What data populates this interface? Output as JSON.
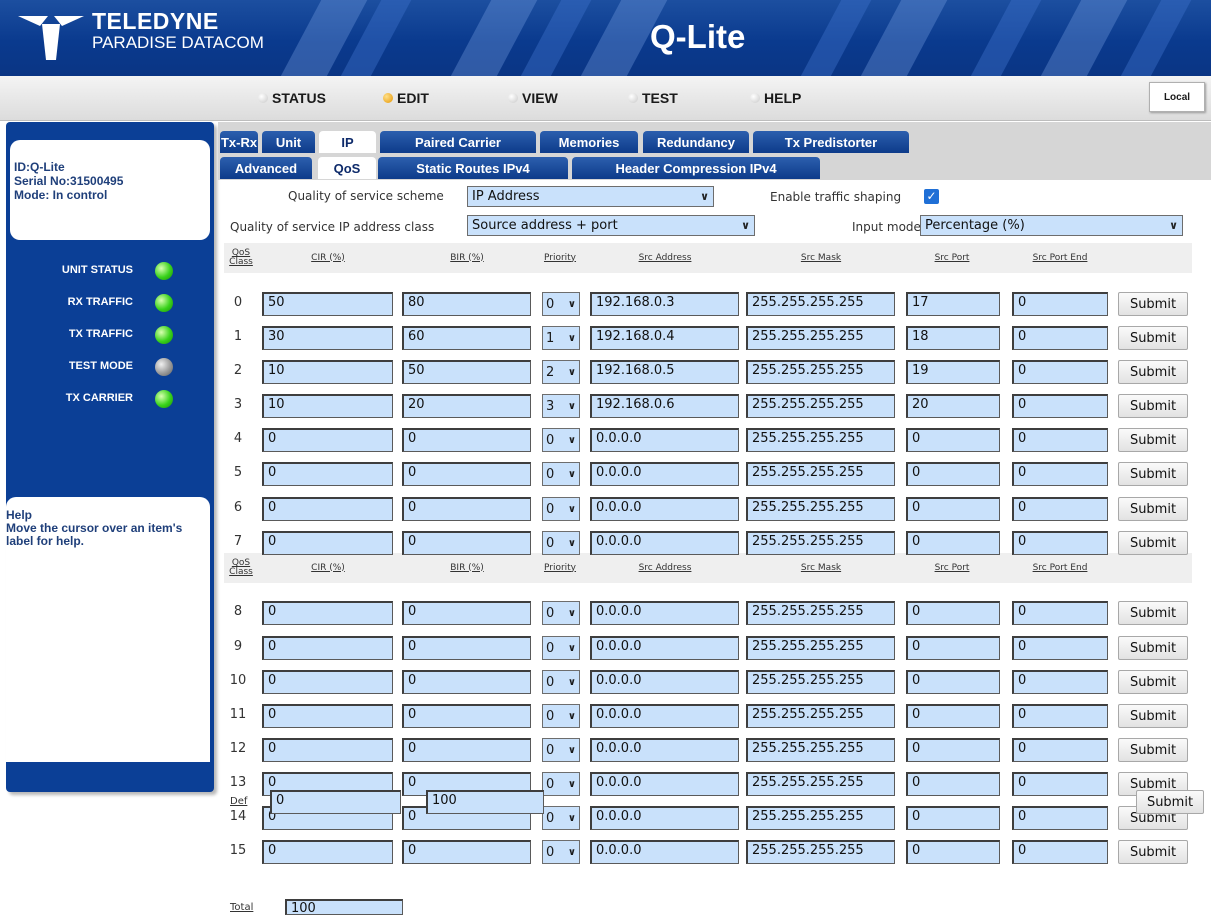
{
  "banner": {
    "brand_line1": "TELEDYNE",
    "brand_line2": "PARADISE DATACOM",
    "product": "Q-Lite"
  },
  "nav": {
    "items": [
      "STATUS",
      "EDIT",
      "VIEW",
      "TEST",
      "HELP"
    ],
    "active": "EDIT",
    "local_button": "Local"
  },
  "unit_info": {
    "id": "ID:Q-Lite",
    "serial": "Serial No:31500495",
    "mode": "Mode: In control"
  },
  "status_indicators": [
    {
      "label": "UNIT STATUS",
      "led": "green"
    },
    {
      "label": "RX TRAFFIC",
      "led": "green"
    },
    {
      "label": "TX TRAFFIC",
      "led": "green"
    },
    {
      "label": "TEST MODE",
      "led": "gray"
    },
    {
      "label": "TX CARRIER",
      "led": "green"
    }
  ],
  "help": {
    "title": "Help",
    "text": "Move the cursor over an item's label for help."
  },
  "tabs_row1": [
    "Tx-Rx",
    "Unit",
    "IP",
    "Paired Carrier",
    "Memories",
    "Redundancy",
    "Tx Predistorter"
  ],
  "tabs_row2": [
    "Advanced",
    "QoS",
    "Static Routes IPv4",
    "Header Compression IPv4"
  ],
  "active_tab_row1": "IP",
  "active_tab_row2": "QoS",
  "form": {
    "scheme_label": "Quality of service scheme",
    "scheme_value": "IP Address",
    "shaping_label": "Enable traffic shaping",
    "shaping_checked": true,
    "class_label": "Quality of service IP address class",
    "class_value": "Source address + port",
    "input_mode_label": "Input mode",
    "input_mode_value": "Percentage (%)"
  },
  "table": {
    "headers": [
      "QoS Class",
      "CIR (%)",
      "BIR (%)",
      "Priority",
      "Src Address",
      "Src Mask",
      "Src Port",
      "Src Port End"
    ],
    "submit_label": "Submit",
    "rows": [
      {
        "cls": "0",
        "cir": "50",
        "bir": "80",
        "prio": "0",
        "addr": "192.168.0.3",
        "mask": "255.255.255.255",
        "port": "17",
        "port_end": "0"
      },
      {
        "cls": "1",
        "cir": "30",
        "bir": "60",
        "prio": "1",
        "addr": "192.168.0.4",
        "mask": "255.255.255.255",
        "port": "18",
        "port_end": "0"
      },
      {
        "cls": "2",
        "cir": "10",
        "bir": "50",
        "prio": "2",
        "addr": "192.168.0.5",
        "mask": "255.255.255.255",
        "port": "19",
        "port_end": "0"
      },
      {
        "cls": "3",
        "cir": "10",
        "bir": "20",
        "prio": "3",
        "addr": "192.168.0.6",
        "mask": "255.255.255.255",
        "port": "20",
        "port_end": "0"
      },
      {
        "cls": "4",
        "cir": "0",
        "bir": "0",
        "prio": "0",
        "addr": "0.0.0.0",
        "mask": "255.255.255.255",
        "port": "0",
        "port_end": "0"
      },
      {
        "cls": "5",
        "cir": "0",
        "bir": "0",
        "prio": "0",
        "addr": "0.0.0.0",
        "mask": "255.255.255.255",
        "port": "0",
        "port_end": "0"
      },
      {
        "cls": "6",
        "cir": "0",
        "bir": "0",
        "prio": "0",
        "addr": "0.0.0.0",
        "mask": "255.255.255.255",
        "port": "0",
        "port_end": "0"
      },
      {
        "cls": "7",
        "cir": "0",
        "bir": "0",
        "prio": "0",
        "addr": "0.0.0.0",
        "mask": "255.255.255.255",
        "port": "0",
        "port_end": "0"
      },
      {
        "cls": "8",
        "cir": "0",
        "bir": "0",
        "prio": "0",
        "addr": "0.0.0.0",
        "mask": "255.255.255.255",
        "port": "0",
        "port_end": "0"
      },
      {
        "cls": "9",
        "cir": "0",
        "bir": "0",
        "prio": "0",
        "addr": "0.0.0.0",
        "mask": "255.255.255.255",
        "port": "0",
        "port_end": "0"
      },
      {
        "cls": "10",
        "cir": "0",
        "bir": "0",
        "prio": "0",
        "addr": "0.0.0.0",
        "mask": "255.255.255.255",
        "port": "0",
        "port_end": "0"
      },
      {
        "cls": "11",
        "cir": "0",
        "bir": "0",
        "prio": "0",
        "addr": "0.0.0.0",
        "mask": "255.255.255.255",
        "port": "0",
        "port_end": "0"
      },
      {
        "cls": "12",
        "cir": "0",
        "bir": "0",
        "prio": "0",
        "addr": "0.0.0.0",
        "mask": "255.255.255.255",
        "port": "0",
        "port_end": "0"
      },
      {
        "cls": "13",
        "cir": "0",
        "bir": "0",
        "prio": "0",
        "addr": "0.0.0.0",
        "mask": "255.255.255.255",
        "port": "0",
        "port_end": "0"
      },
      {
        "cls": "14",
        "cir": "0",
        "bir": "0",
        "prio": "0",
        "addr": "0.0.0.0",
        "mask": "255.255.255.255",
        "port": "0",
        "port_end": "0"
      },
      {
        "cls": "15",
        "cir": "0",
        "bir": "0",
        "prio": "0",
        "addr": "0.0.0.0",
        "mask": "255.255.255.255",
        "port": "0",
        "port_end": "0"
      }
    ],
    "def_label": "Def",
    "def_cir": "0",
    "def_bir": "100",
    "total_label": "Total",
    "total_value": "100"
  },
  "colors": {
    "brand_blue": "#0b3f96",
    "field_fill": "#c9e1fb",
    "led_green": "#38d21a",
    "led_gray": "#9a9a9a"
  },
  "icons": [
    "teledyne-logo-icon",
    "nav-dot-icon",
    "led-icon",
    "chevron-down-icon",
    "checkbox-checked-icon"
  ]
}
